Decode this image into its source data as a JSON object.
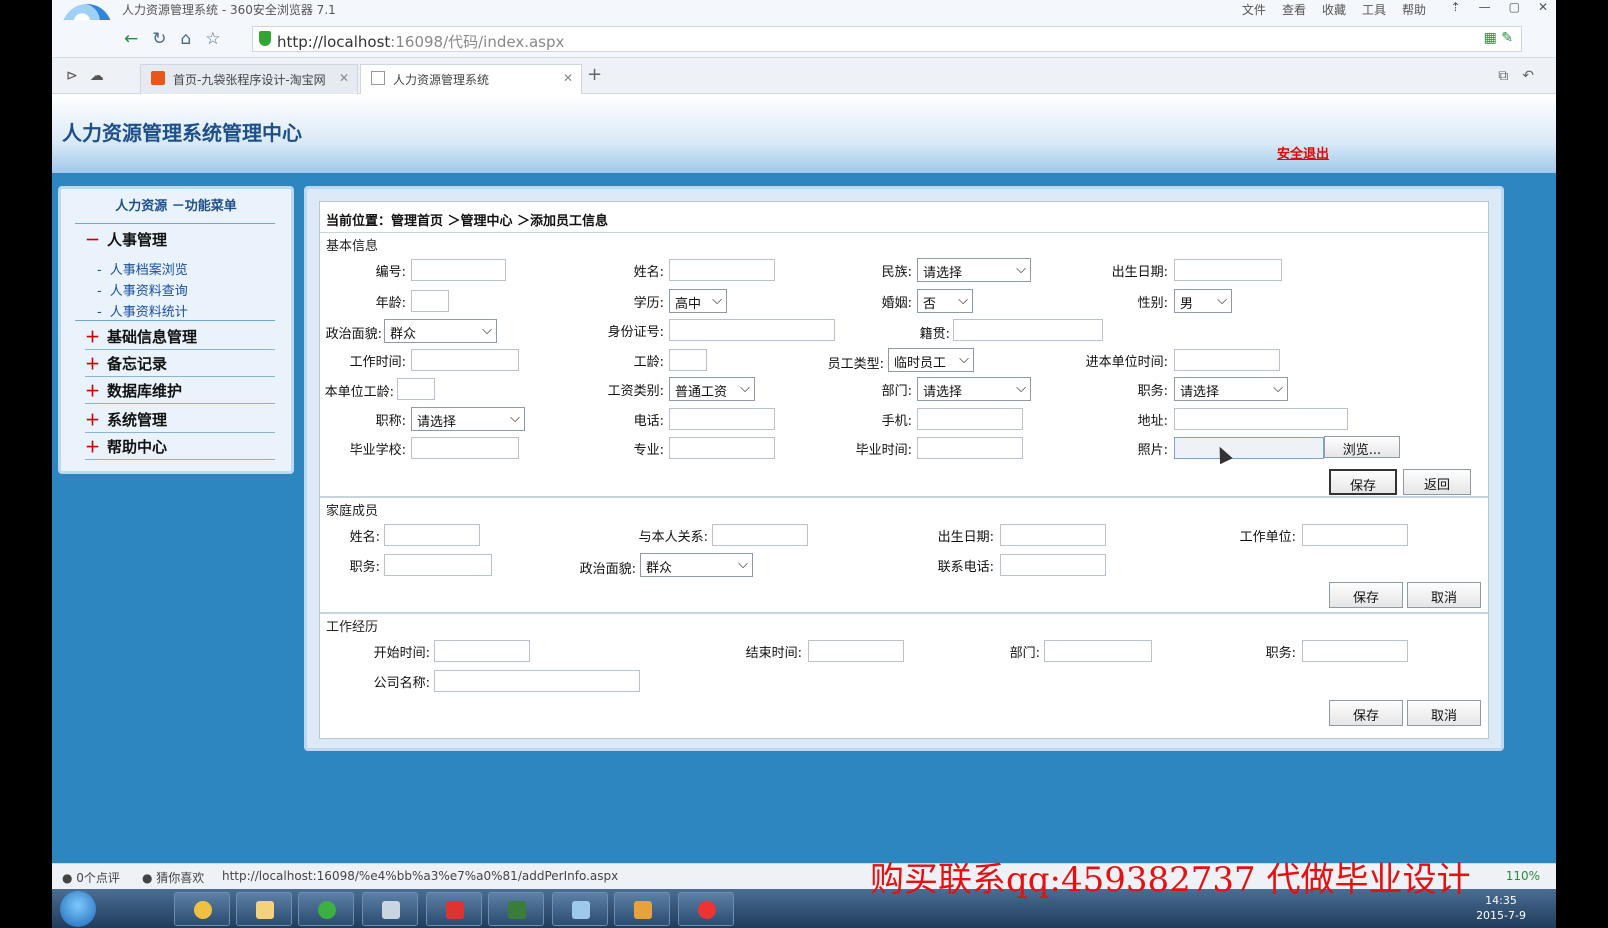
{
  "browser": {
    "window_title": "人力资源管理系统 - 360安全浏览器 7.1",
    "menus": [
      "文件",
      "查看",
      "收藏",
      "工具",
      "帮助"
    ],
    "url_host": "http://localhost",
    "url_path": ":16098/代码/index.aspx",
    "tabs": [
      {
        "label": "首页-九袋张程序设计-淘宝网"
      },
      {
        "label": "人力资源管理系统"
      }
    ]
  },
  "header": {
    "title": "人力资源管理系统管理中心",
    "logout": "安全退出"
  },
  "sidebar": {
    "title": "人力资源  －功能菜单",
    "groups": [
      {
        "sign": "－",
        "label": "人事管理",
        "items": [
          "人事档案浏览",
          "人事资料查询",
          "人事资料统计"
        ]
      },
      {
        "sign": "＋",
        "label": "基础信息管理"
      },
      {
        "sign": "＋",
        "label": "备忘记录"
      },
      {
        "sign": "＋",
        "label": "数据库维护"
      },
      {
        "sign": "＋",
        "label": "系统管理"
      },
      {
        "sign": "＋",
        "label": "帮助中心"
      }
    ]
  },
  "breadcrumb": "当前位置：管理首页 ＞管理中心 ＞添加员工信息",
  "basic": {
    "title": "基本信息",
    "labels": {
      "id": "编号:",
      "name": "姓名:",
      "ethnic": "民族:",
      "birth": "出生日期:",
      "age": "年龄:",
      "edu": "学历:",
      "marriage": "婚姻:",
      "gender": "性别:",
      "political": "政治面貌:",
      "idcard": "身份证号:",
      "native": "籍贯:",
      "worktime": "工作时间:",
      "seniority": "工龄:",
      "emptype": "员工类型:",
      "jointime": "进本单位时间:",
      "unitage": "本单位工龄:",
      "salary": "工资类别:",
      "dept": "部门:",
      "post": "职务:",
      "title": "职称:",
      "phone": "电话:",
      "mobile": "手机:",
      "address": "地址:",
      "school": "毕业学校:",
      "major": "专业:",
      "gradtime": "毕业时间:",
      "photo": "照片:"
    },
    "selects": {
      "ethnic": "请选择",
      "edu": "高中",
      "marriage": "否",
      "gender": "男",
      "political": "群众",
      "emptype": "临时员工",
      "salary": "普通工资",
      "dept": "请选择",
      "post": "请选择",
      "title": "请选择"
    },
    "browse": "浏览...",
    "save": "保存",
    "back": "返回"
  },
  "family": {
    "title": "家庭成员",
    "labels": {
      "name": "姓名:",
      "relation": "与本人关系:",
      "birth": "出生日期:",
      "workunit": "工作单位:",
      "post": "职务:",
      "political": "政治面貌:",
      "phone": "联系电话:"
    },
    "political_value": "群众",
    "save": "保存",
    "cancel": "取消"
  },
  "work": {
    "title": "工作经历",
    "labels": {
      "start": "开始时间:",
      "end": "结束时间:",
      "dept": "部门:",
      "post": "职务:",
      "company": "公司名称:"
    },
    "save": "保存",
    "cancel": "取消"
  },
  "statusbar": {
    "reviews": "0个点评",
    "guess": "猜你喜欢",
    "link": "http://localhost:16098/%e4%bb%a3%e7%a0%81/addPerInfo.aspx",
    "zoom": "110%"
  },
  "taskbar": {
    "time": "14:35",
    "date": "2015-7-9"
  },
  "watermark": "购买联系qq:459382737 代做毕业设计"
}
